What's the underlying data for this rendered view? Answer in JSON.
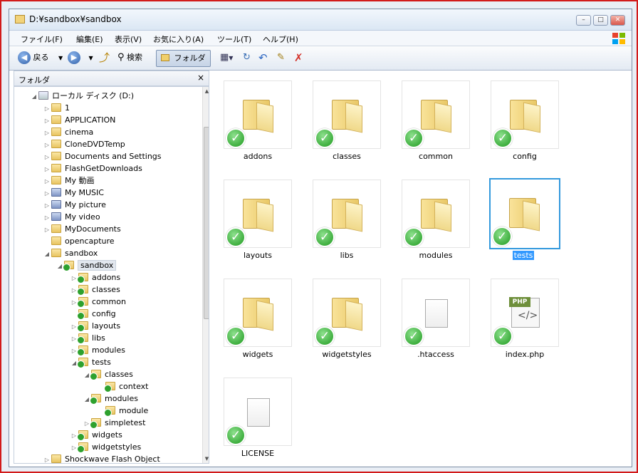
{
  "window": {
    "title": "D:¥sandbox¥sandbox",
    "min": "–",
    "max": "□",
    "close": "✕"
  },
  "menu": [
    "ファイル(F)",
    "編集(E)",
    "表示(V)",
    "お気に入り(A)",
    "ツール(T)",
    "ヘルプ(H)"
  ],
  "toolbar": {
    "back": "戻る",
    "search": "検索",
    "folders": "フォルダ"
  },
  "pane": {
    "title": "フォルダ",
    "close": "×"
  },
  "tree": {
    "drive": "ローカル ディスク (D:)",
    "root_items": [
      "1",
      "APPLICATION",
      "cinema",
      "CloneDVDTemp",
      "Documents and Settings",
      "FlashGetDownloads",
      "My 動画",
      "My MUSIC",
      "My picture",
      "My video",
      "MyDocuments",
      "opencapture",
      "sandbox"
    ],
    "sandbox_child": "sandbox",
    "sub_items": [
      "addons",
      "classes",
      "common",
      "config",
      "layouts",
      "libs",
      "modules",
      "tests"
    ],
    "tests_children": [
      "classes",
      "modules"
    ],
    "classes_child": "context",
    "modules_child": "module",
    "tests_last": "simpletest",
    "after_tests": [
      "widgets",
      "widgetstyles"
    ],
    "last_root": "Shockwave Flash Object"
  },
  "files": [
    {
      "name": "addons",
      "type": "folder"
    },
    {
      "name": "classes",
      "type": "folder"
    },
    {
      "name": "common",
      "type": "folder"
    },
    {
      "name": "config",
      "type": "folder"
    },
    {
      "name": "layouts",
      "type": "folder"
    },
    {
      "name": "libs",
      "type": "folder"
    },
    {
      "name": "modules",
      "type": "folder"
    },
    {
      "name": "tests",
      "type": "folder",
      "selected": true
    },
    {
      "name": "widgets",
      "type": "folder"
    },
    {
      "name": "widgetstyles",
      "type": "folder"
    },
    {
      "name": ".htaccess",
      "type": "file"
    },
    {
      "name": "index.php",
      "type": "php"
    },
    {
      "name": "LICENSE",
      "type": "file"
    }
  ],
  "php_tag": "PHP",
  "icons": [
    "folder-icon",
    "checkmark-overlay-icon",
    "back-icon",
    "forward-icon",
    "search-icon",
    "delete-icon",
    "undo-icon",
    "windows-logo-icon"
  ],
  "colors": {
    "frame": "#d21a1a",
    "selection": "#3399dd",
    "check": "#1e9a1e"
  }
}
